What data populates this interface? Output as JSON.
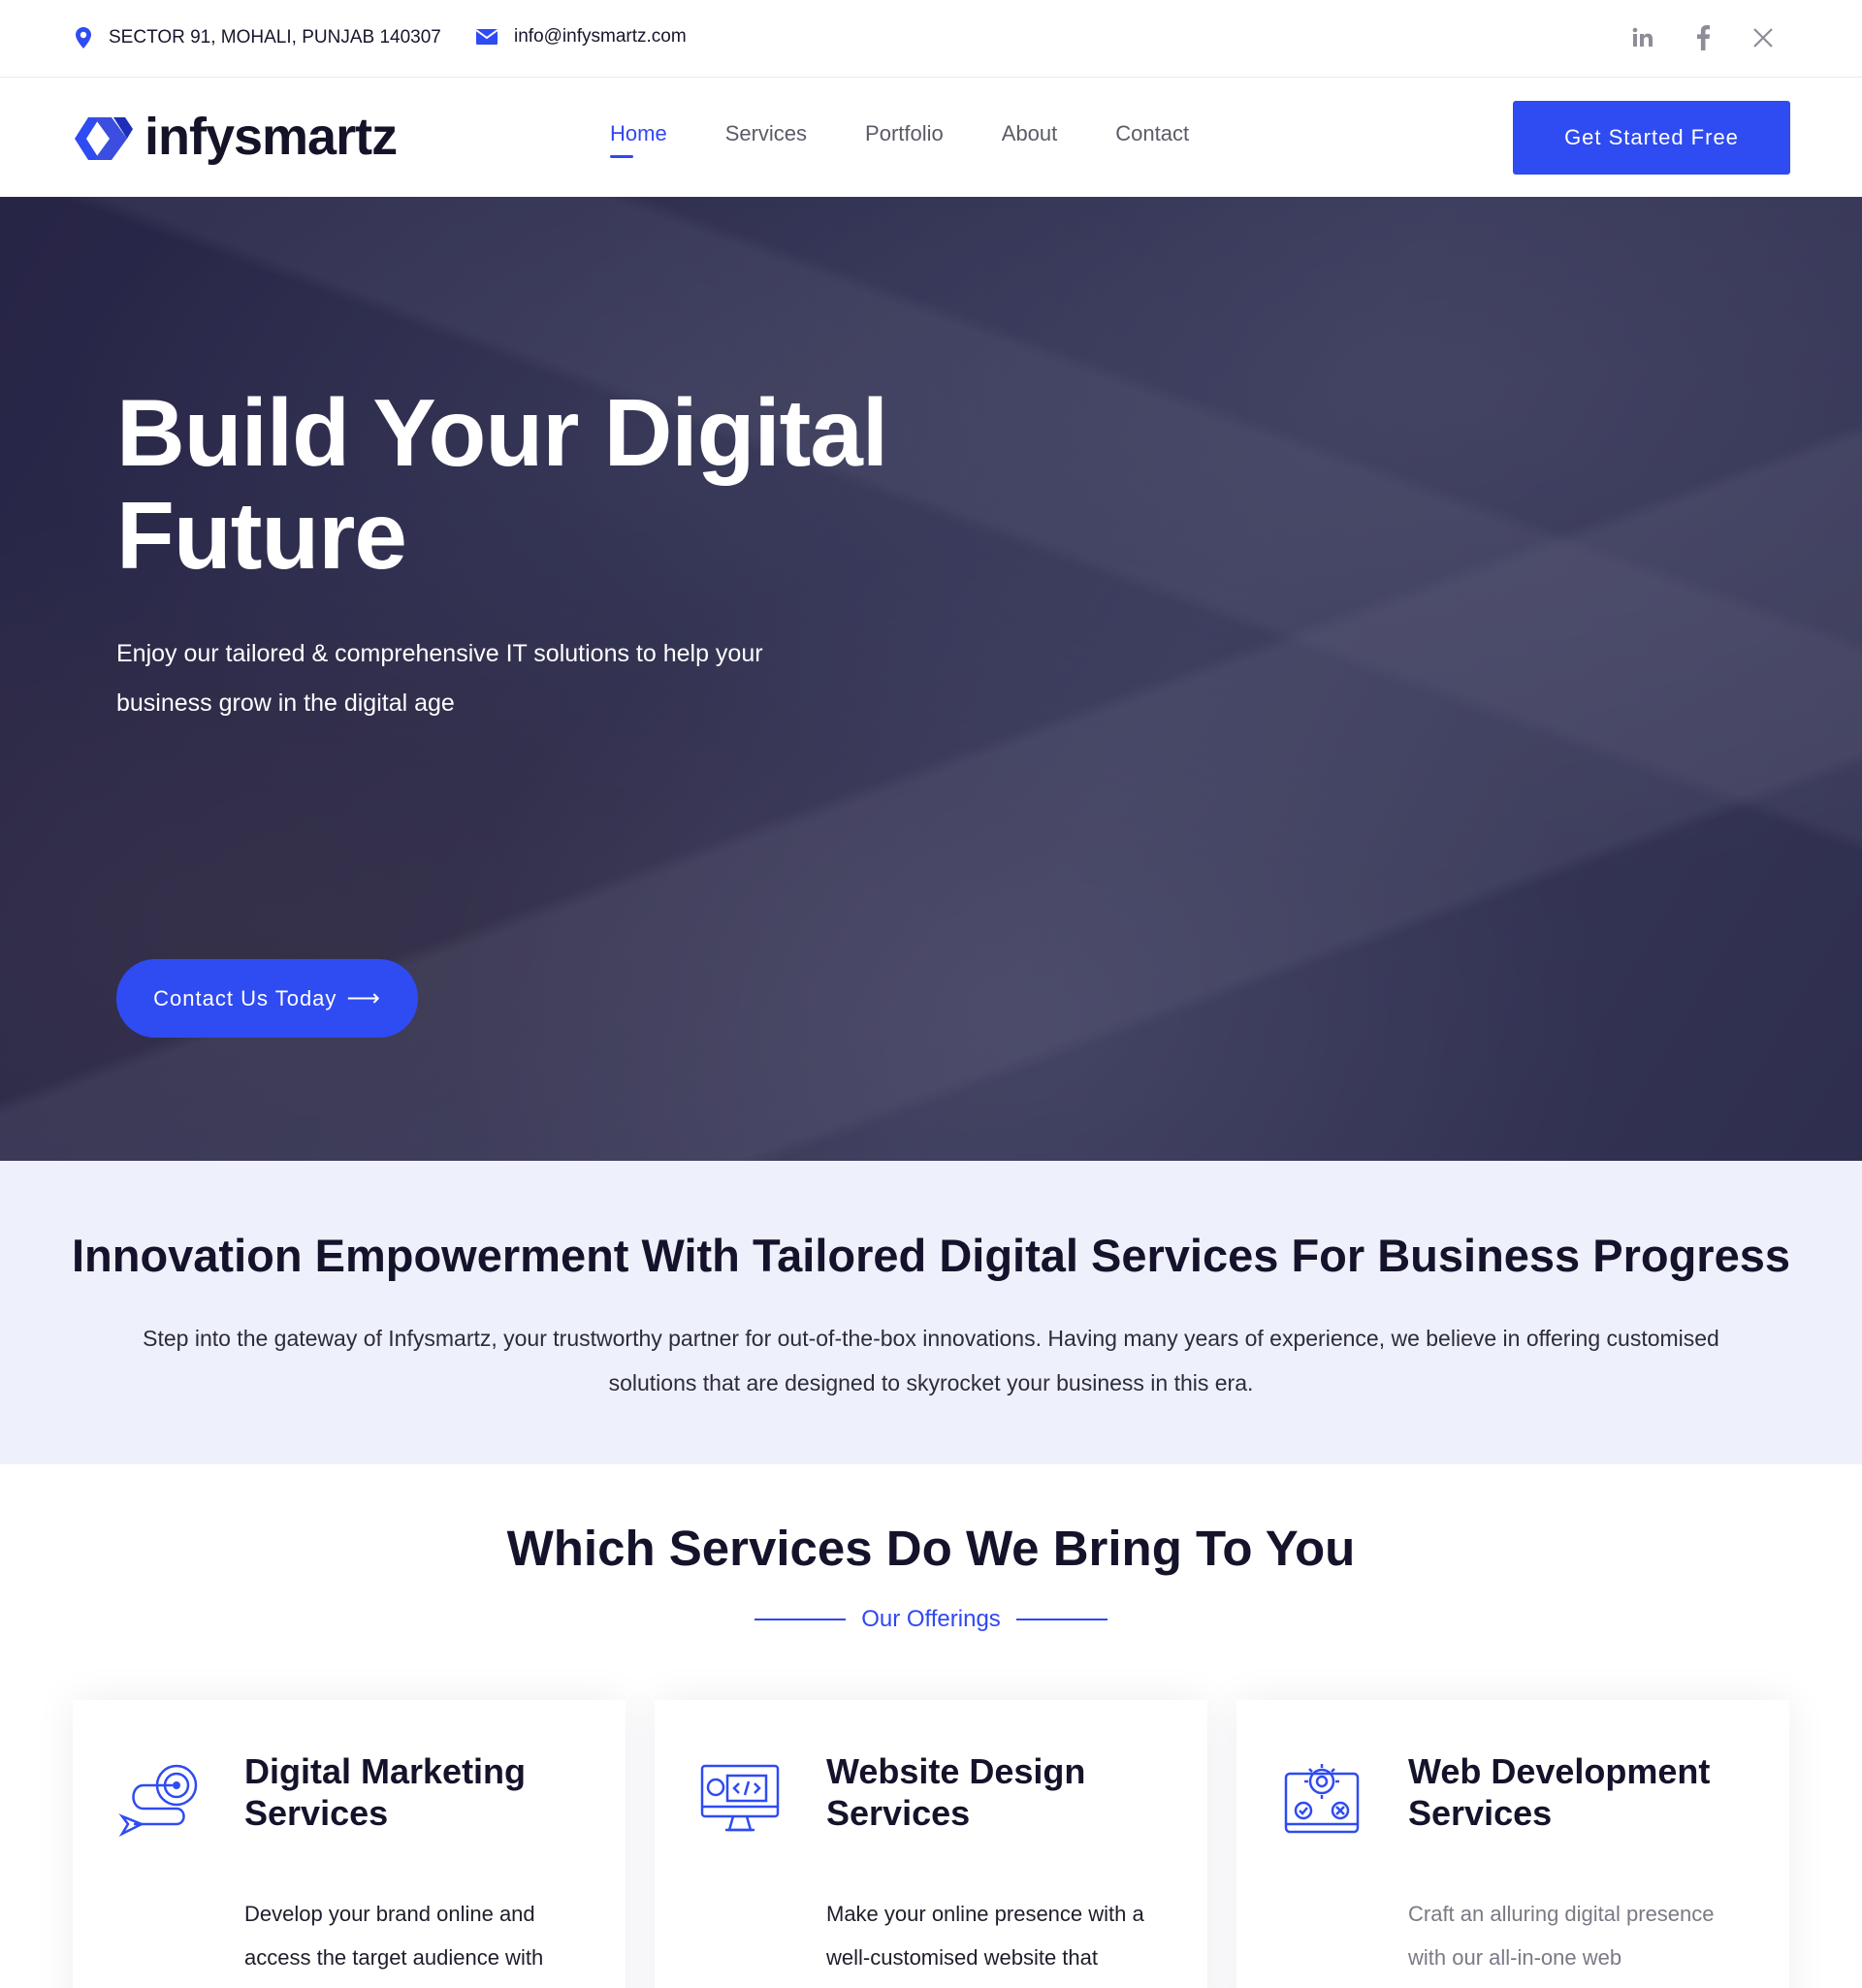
{
  "topbar": {
    "address": "SECTOR 91, MOHALI, PUNJAB 140307",
    "email": "info@infysmartz.com",
    "socials": [
      "linkedin-icon",
      "facebook-icon",
      "x-icon"
    ]
  },
  "header": {
    "logo_text": "infysmartz",
    "nav": [
      "Home",
      "Services",
      "Portfolio",
      "About",
      "Contact"
    ],
    "active_nav": "Home",
    "cta": "Get Started Free"
  },
  "hero": {
    "title_line1": "Build Your Digital",
    "title_line2": "Future",
    "subtitle": "Enjoy our tailored & comprehensive IT solutions to help your business grow in the digital age",
    "button": "Contact Us Today"
  },
  "intro": {
    "heading": "Innovation Empowerment With Tailored Digital Services For Business Progress",
    "text": "Step into the gateway of Infysmartz, your trustworthy partner for out-of-the-box innovations. Having many years of experience, we believe in offering customised solutions that are designed to skyrocket your business in this era."
  },
  "services": {
    "heading": "Which Services Do We Bring To You",
    "tag": "Our Offerings",
    "cards": [
      {
        "icon": "target-arrow-icon",
        "title": "Digital Marketing Services",
        "desc": "Develop your brand online and access the target audience with"
      },
      {
        "icon": "monitor-code-icon",
        "title": "Website Design Services",
        "desc": "Make your online presence with a well-customised website that"
      },
      {
        "icon": "gear-laptop-icon",
        "title": "Web Development Services",
        "desc": "Craft an alluring digital presence with our all-in-one web"
      }
    ]
  },
  "colors": {
    "accent": "#2f4bf2",
    "intro_bg": "#eef0fb",
    "heading": "#14132b"
  }
}
